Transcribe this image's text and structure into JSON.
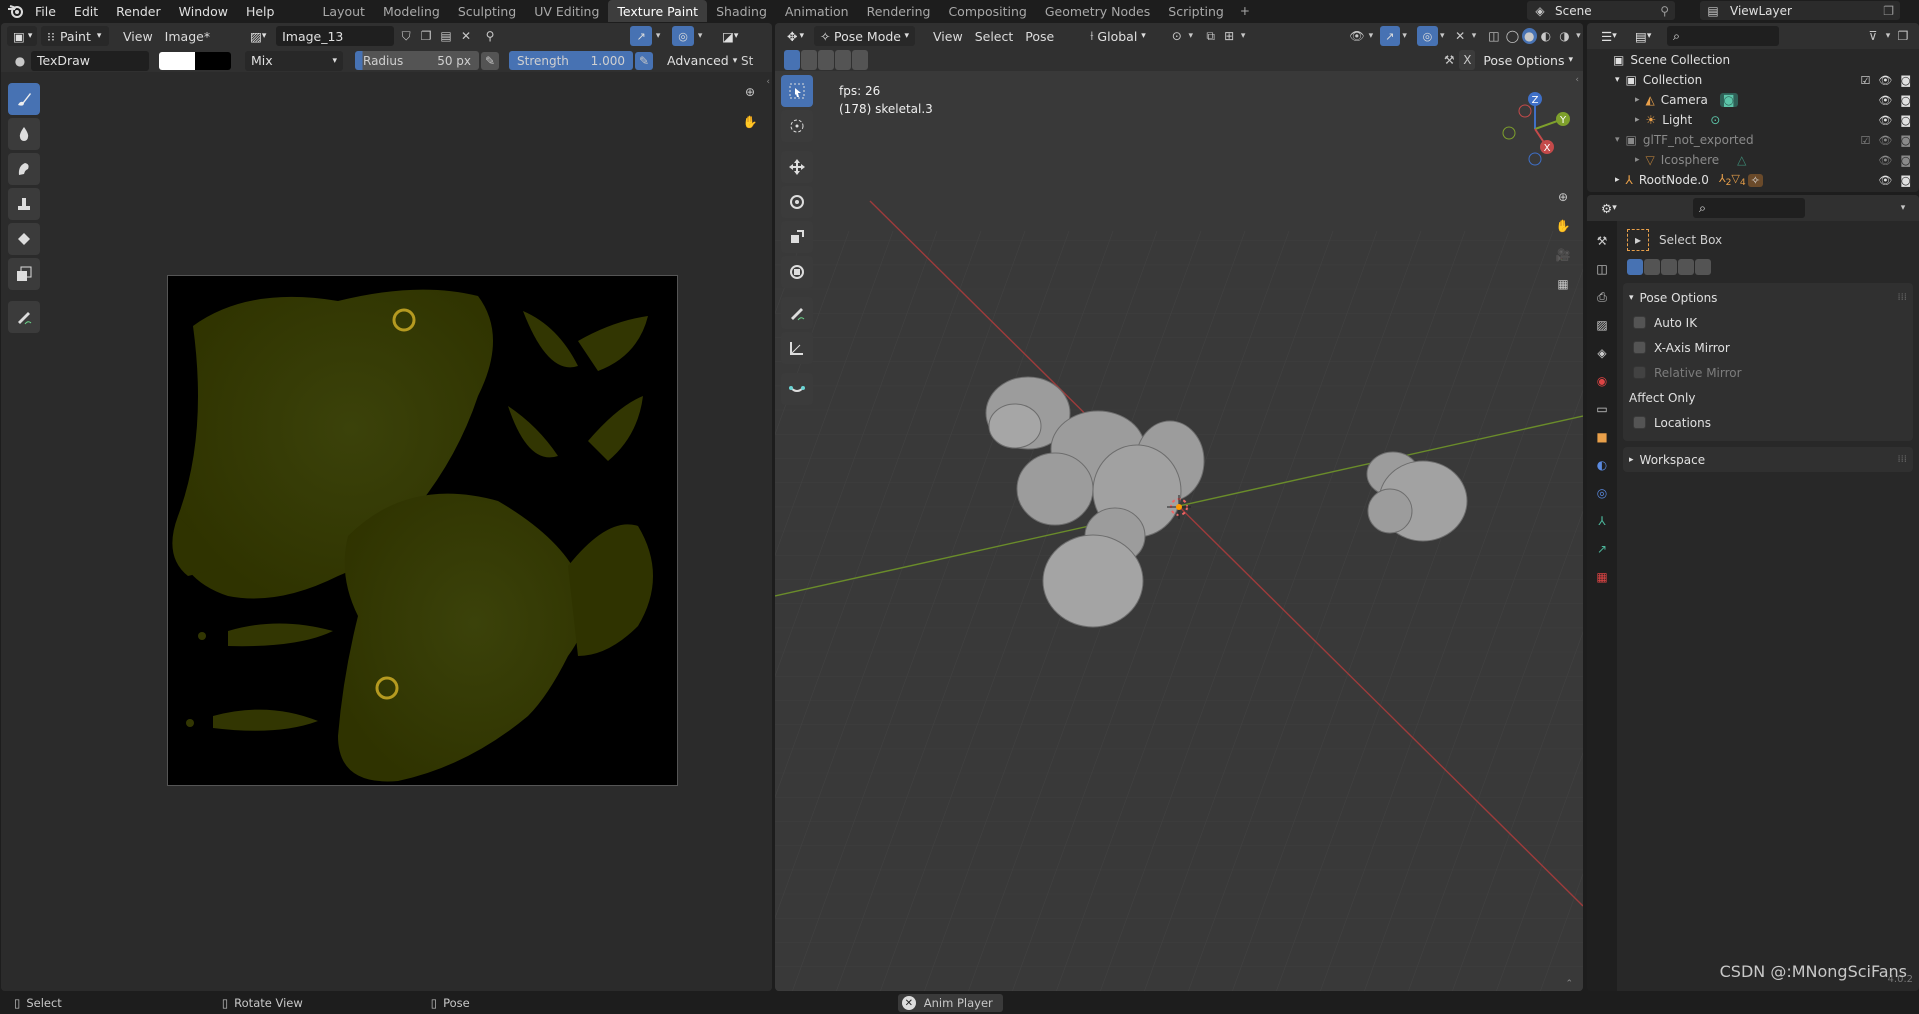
{
  "topbar": {
    "menus": [
      "File",
      "Edit",
      "Render",
      "Window",
      "Help"
    ],
    "workspaces": [
      "Layout",
      "Modeling",
      "Sculpting",
      "UV Editing",
      "Texture Paint",
      "Shading",
      "Animation",
      "Rendering",
      "Compositing",
      "Geometry Nodes",
      "Scripting"
    ],
    "active_workspace": "Texture Paint",
    "add_workspace": "+",
    "scene": "Scene",
    "view_layer": "ViewLayer"
  },
  "image_editor": {
    "mode": "Paint",
    "view_menu": "View",
    "image_menu": "Image*",
    "image_name": "Image_13",
    "brush_name": "TexDraw",
    "blend": "Mix",
    "radius_label": "Radius",
    "radius_value": "50 px",
    "strength_label": "Strength",
    "strength_value": "1.000",
    "advanced": "Advanced",
    "cut_label": "St",
    "tools": [
      "brush-icon",
      "fill-drop-icon",
      "smear-icon",
      "clone-stamp-icon",
      "fill-bucket-icon",
      "mask-icon",
      "annotate-icon"
    ],
    "texture_color": "#2f3300"
  },
  "viewport": {
    "mode": "Pose Mode",
    "menus": [
      "View",
      "Select",
      "Pose"
    ],
    "orientation": "Global",
    "pose_options": "Pose Options",
    "close_x": "X",
    "fps": "fps: 26",
    "object_info": "(178) skeletal.3",
    "tools": [
      "select-box-icon",
      "cursor-icon",
      "move-icon",
      "rotate-icon",
      "scale-icon",
      "transform-icon",
      "annotate-icon",
      "measure-icon",
      "bone-tool-icon"
    ],
    "gizmo": {
      "z": "Z",
      "y": "Y",
      "x": "X"
    },
    "x_axis_color": "#c44a4a",
    "y_axis_color": "#7a9a2c"
  },
  "outliner": {
    "rows": [
      {
        "label": "Scene Collection"
      },
      {
        "label": "Collection"
      },
      {
        "label": "Camera"
      },
      {
        "label": "Light"
      },
      {
        "label": "glTF_not_exported"
      },
      {
        "label": "Icosphere"
      },
      {
        "label": "RootNode.0"
      }
    ],
    "badge_2": "2",
    "badge_4": "4"
  },
  "properties": {
    "tool_name": "Select Box",
    "panel_pose_options": "Pose Options",
    "auto_ik": "Auto IK",
    "x_mirror": "X-Axis Mirror",
    "relative_mirror": "Relative Mirror",
    "affect_only": "Affect Only",
    "locations": "Locations",
    "panel_workspace": "Workspace"
  },
  "statusbar": {
    "select": "Select",
    "rotate": "Rotate View",
    "pose": "Pose",
    "anim_player": "Anim Player",
    "version": "4.0.2"
  },
  "watermark": "CSDN @:MNongSciFans"
}
